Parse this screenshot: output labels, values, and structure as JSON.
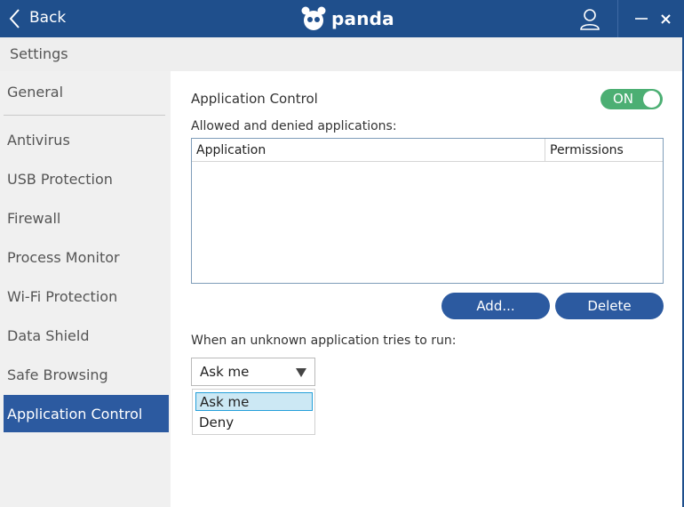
{
  "titlebar": {
    "back_label": "Back",
    "logo_text": "panda",
    "minimize_label": "—",
    "close_label": "x"
  },
  "header": {
    "title": "Settings"
  },
  "sidebar": {
    "items": [
      {
        "label": "General"
      },
      {
        "label": "Antivirus"
      },
      {
        "label": "USB Protection"
      },
      {
        "label": "Firewall"
      },
      {
        "label": "Process Monitor"
      },
      {
        "label": "Wi-Fi Protection"
      },
      {
        "label": "Data Shield"
      },
      {
        "label": "Safe Browsing"
      },
      {
        "label": "Application Control"
      }
    ],
    "active_index": 8
  },
  "main": {
    "app_control": {
      "label": "Application Control",
      "toggle_label": "ON",
      "enabled": true
    },
    "apps_list": {
      "label": "Allowed and denied applications:",
      "columns": [
        "Application",
        "Permissions"
      ],
      "rows": []
    },
    "buttons": {
      "add": "Add...",
      "delete": "Delete"
    },
    "unknown_app": {
      "label": "When an unknown application tries to run:",
      "selected": "Ask me",
      "options": [
        "Ask me",
        "Deny"
      ]
    }
  },
  "colors": {
    "titlebar": "#1f4f8c",
    "accent": "#2c5aa0",
    "toggle_on": "#4caf73",
    "sidebar_bg": "#f0f0f0"
  }
}
